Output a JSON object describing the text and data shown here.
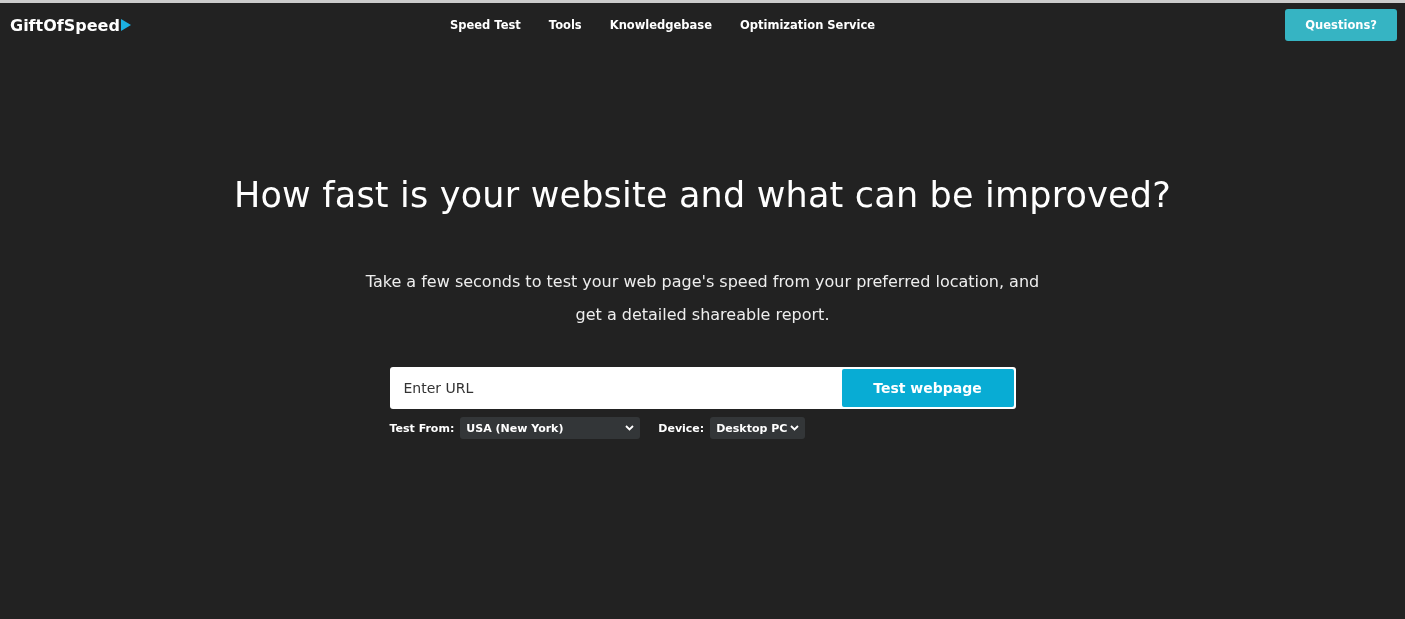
{
  "header": {
    "logo": "GiftOfSpeed",
    "nav": [
      {
        "label": "Speed Test"
      },
      {
        "label": "Tools"
      },
      {
        "label": "Knowledgebase"
      },
      {
        "label": "Optimization Service"
      }
    ],
    "cta": "Questions?"
  },
  "hero": {
    "title": "How fast is your website and what can be improved?",
    "subtitle": "Take a few seconds to test your web page's speed from your preferred location, and get a detailed shareable report.",
    "url_field": {
      "placeholder": "Enter URL"
    },
    "submit": "Test webpage",
    "options": [
      {
        "label": "Test From:",
        "value": "USA (New York)",
        "kind": "wide"
      },
      {
        "label": "Device:",
        "value": "Desktop PC",
        "kind": "narrow"
      }
    ]
  }
}
